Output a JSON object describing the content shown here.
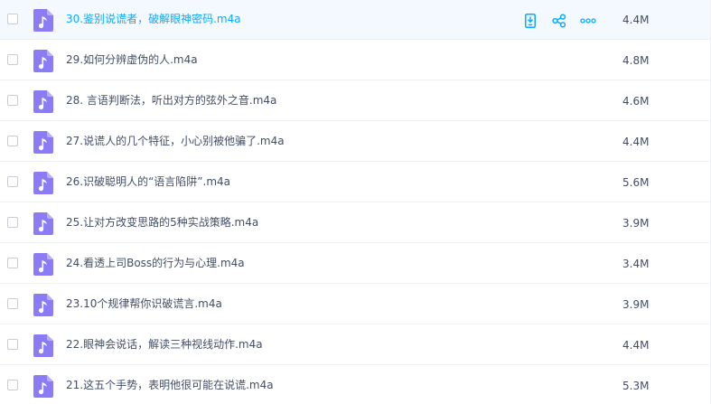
{
  "files": [
    {
      "name": "30.鉴别说谎者，破解眼神密码.m4a",
      "size": "4.4M"
    },
    {
      "name": "29.如何分辨虚伪的人.m4a",
      "size": "4.8M"
    },
    {
      "name": "28. 言语判断法，听出对方的弦外之音.m4a",
      "size": "4.6M"
    },
    {
      "name": "27.说谎人的几个特征，小心别被他骗了.m4a",
      "size": "4.4M"
    },
    {
      "name": "26.识破聪明人的“语言陷阱”.m4a",
      "size": "5.6M"
    },
    {
      "name": "25.让对方改变思路的5种实战策略.m4a",
      "size": "3.9M"
    },
    {
      "name": "24.看透上司Boss的行为与心理.m4a",
      "size": "3.4M"
    },
    {
      "name": "23.10个规律帮你识破谎言.m4a",
      "size": "3.9M"
    },
    {
      "name": "22.眼神会说话，解读三种视线动作.m4a",
      "size": "4.4M"
    },
    {
      "name": "21.这五个手势，表明他很可能在说谎.m4a",
      "size": "5.3M"
    }
  ],
  "hovered_row": 0,
  "icons": {
    "file": "music-file-icon",
    "actions": [
      "phone-download-icon",
      "share-icon",
      "more-icon"
    ]
  },
  "colors": {
    "accent": "#09aaff",
    "text": "#424e67",
    "file_icon": "#8b7cf6",
    "hover_bg": "#f4f9ff"
  }
}
